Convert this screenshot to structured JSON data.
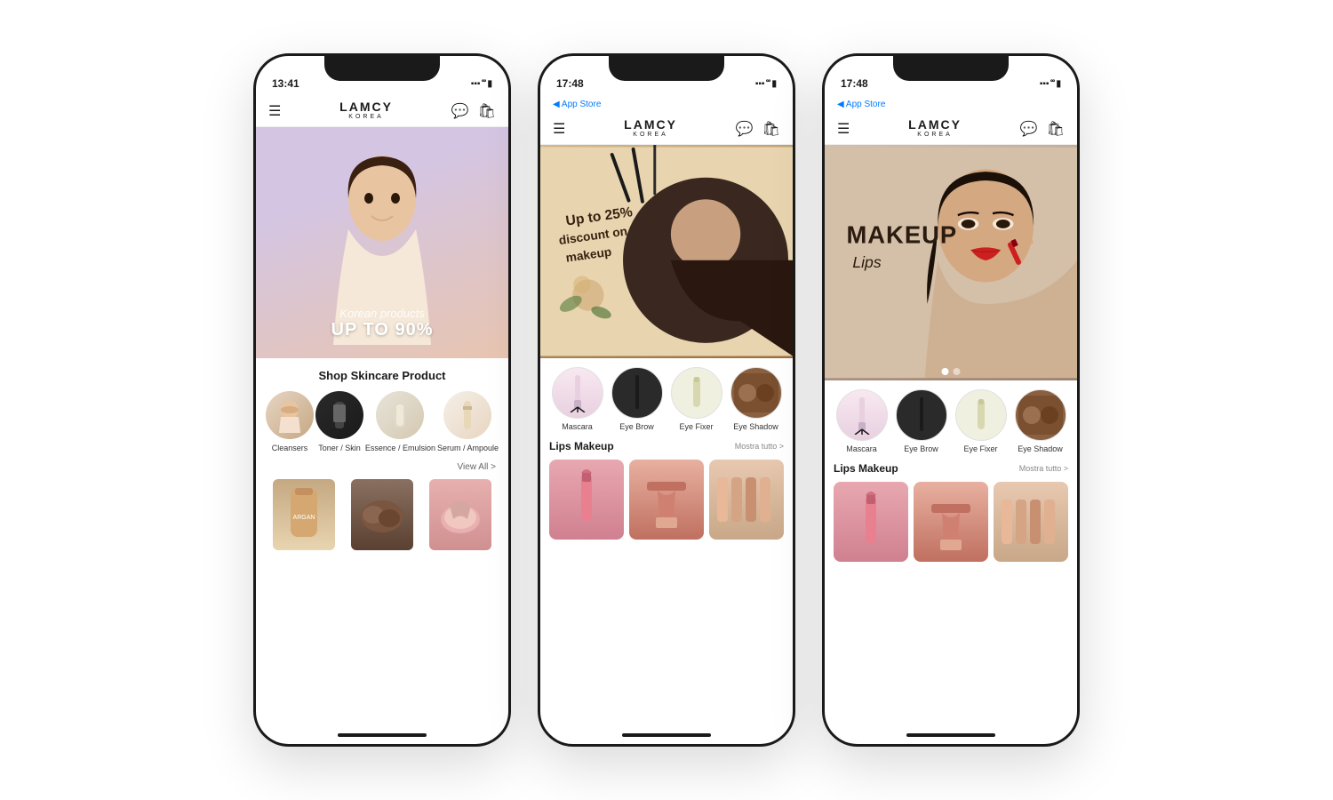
{
  "phones": [
    {
      "id": "phone-1",
      "statusBar": {
        "time": "13:41",
        "hasAppStore": false,
        "appStoreText": ""
      },
      "brand": {
        "name": "LAMCY",
        "sub": "KOREA"
      },
      "hero": {
        "type": "skincare",
        "bannerSmallText": "Korean products",
        "bannerLargeText": "UP TO 90%"
      },
      "sectionTitle": "Shop Skincare Product",
      "categories": [
        {
          "label": "Cleansers",
          "icon": "👧"
        },
        {
          "label": "Toner / Skin",
          "icon": "🌿"
        },
        {
          "label": "Essence /\nEmulsion",
          "icon": "💧"
        },
        {
          "label": "Serum /\nAmpoule",
          "icon": "✨"
        }
      ],
      "viewAll": "View All >",
      "products": [
        {
          "icon": "🧴",
          "bg": "prod-tube"
        },
        {
          "icon": "🪞",
          "bg": "prod-compact"
        },
        {
          "icon": "🌸",
          "bg": "prod-blush"
        }
      ]
    },
    {
      "id": "phone-2",
      "statusBar": {
        "time": "17:48",
        "hasAppStore": true,
        "appStoreText": "◀ App Store"
      },
      "brand": {
        "name": "LAMCY",
        "sub": "KOREA"
      },
      "hero": {
        "type": "makeup-discount",
        "discountLine1": "Up to 25% discount",
        "discountLine2": "on makeup"
      },
      "makeupCategories": [
        {
          "label": "Mascara",
          "bg": "prod-mascara"
        },
        {
          "label": "Eye Brow",
          "bg": "prod-eyebrow"
        },
        {
          "label": "Eye Fixer",
          "bg": "prod-fixer"
        },
        {
          "label": "Eye Shadow",
          "bg": "prod-eyeshadow"
        }
      ],
      "lipsSection": {
        "title": "Lips Makeup",
        "viewAll": "Mostra tutto >"
      },
      "lipsProducts": [
        {
          "icon": "💄",
          "bg": "prod-lipstick"
        },
        {
          "icon": "💋",
          "bg": "prod-gloss"
        },
        {
          "icon": "🌹",
          "bg": "prod-set"
        }
      ]
    },
    {
      "id": "phone-3",
      "statusBar": {
        "time": "17:48",
        "hasAppStore": true,
        "appStoreText": "◀ App Store"
      },
      "brand": {
        "name": "LAMCY",
        "sub": "KOREA"
      },
      "hero": {
        "type": "makeup-lips",
        "titleLine1": "MAKEUP",
        "titleLine2": "Lips"
      },
      "slideDots": [
        true,
        false
      ],
      "makeupCategories": [
        {
          "label": "Mascara",
          "bg": "prod-mascara"
        },
        {
          "label": "Eye Brow",
          "bg": "prod-eyebrow"
        },
        {
          "label": "Eye Fixer",
          "bg": "prod-fixer"
        },
        {
          "label": "Eye Shadow",
          "bg": "prod-eyeshadow"
        }
      ],
      "lipsSection": {
        "title": "Lips Makeup",
        "viewAll": "Mostra tutto >"
      },
      "lipsProducts": [
        {
          "icon": "💄",
          "bg": "prod-lipstick"
        },
        {
          "icon": "💋",
          "bg": "prod-gloss"
        },
        {
          "icon": "🌹",
          "bg": "prod-set"
        }
      ]
    }
  ],
  "icons": {
    "menu": "☰",
    "chat": "💬",
    "bag": "🛍",
    "signal": "▪▪▪",
    "wifi": "wifi",
    "battery": "▮"
  }
}
